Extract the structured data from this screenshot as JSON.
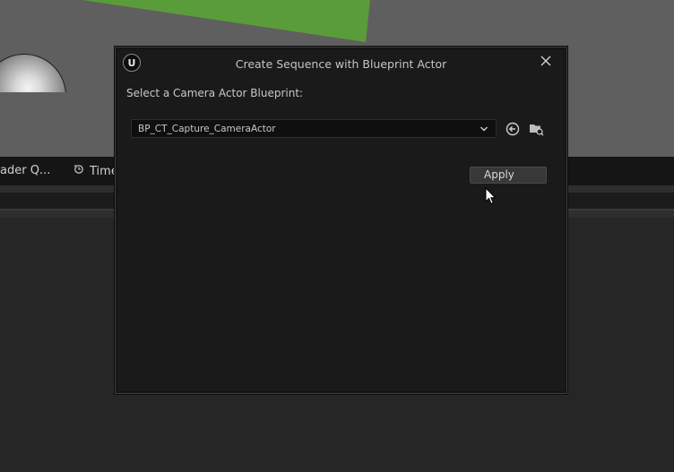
{
  "background": {
    "tabs": [
      {
        "label": "ader Q..."
      },
      {
        "label": "Time"
      }
    ]
  },
  "dialog": {
    "title": "Create Sequence with Blueprint Actor",
    "close_icon": "close-icon",
    "prompt": "Select a Camera Actor Blueprint:",
    "combo_value": "BP_CT_Capture_CameraActor",
    "apply_label": "Apply"
  },
  "colors": {
    "dialog_bg": "#1a1a1a",
    "accent_green": "#5a9c3a",
    "panel_bg": "#262626"
  }
}
